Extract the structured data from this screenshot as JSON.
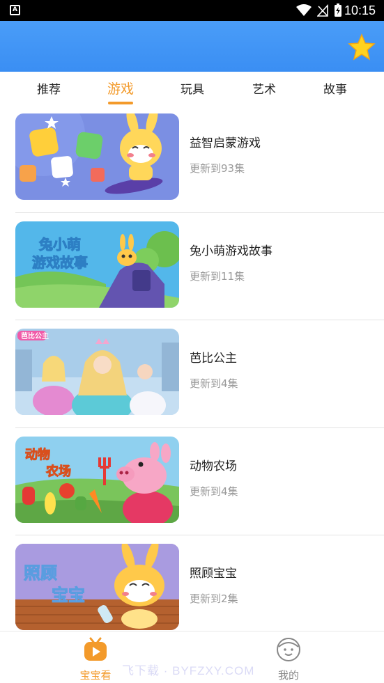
{
  "status_bar": {
    "app_badge": "A",
    "time": "10:15",
    "icons": [
      "wifi-icon",
      "no-signal-icon",
      "battery-charging-icon"
    ]
  },
  "header": {
    "favorite_icon": "star-icon",
    "accent_color": "#3a8ef3"
  },
  "tabs": [
    {
      "label": "推荐",
      "active": false
    },
    {
      "label": "游戏",
      "active": true
    },
    {
      "label": "玩具",
      "active": false
    },
    {
      "label": "艺术",
      "active": false
    },
    {
      "label": "故事",
      "active": false
    }
  ],
  "list": [
    {
      "title": "益智启蒙游戏",
      "subtitle": "更新到93集",
      "thumb_text": ""
    },
    {
      "title": "兔小萌游戏故事",
      "subtitle": "更新到11集",
      "thumb_text": "兔小萌游戏故事"
    },
    {
      "title": "芭比公主",
      "subtitle": "更新到4集",
      "thumb_text": "芭比公主"
    },
    {
      "title": "动物农场",
      "subtitle": "更新到4集",
      "thumb_text": "动物农场"
    },
    {
      "title": "照顾宝宝",
      "subtitle": "更新到2集",
      "thumb_text": "照顾宝宝"
    }
  ],
  "bottom_nav": {
    "home_label": "宝宝看",
    "mine_label": "我的",
    "watermark": "飞下载 · BYFZXY.COM"
  },
  "colors": {
    "active": "#f39a2a",
    "header": "#3a8ef3"
  }
}
